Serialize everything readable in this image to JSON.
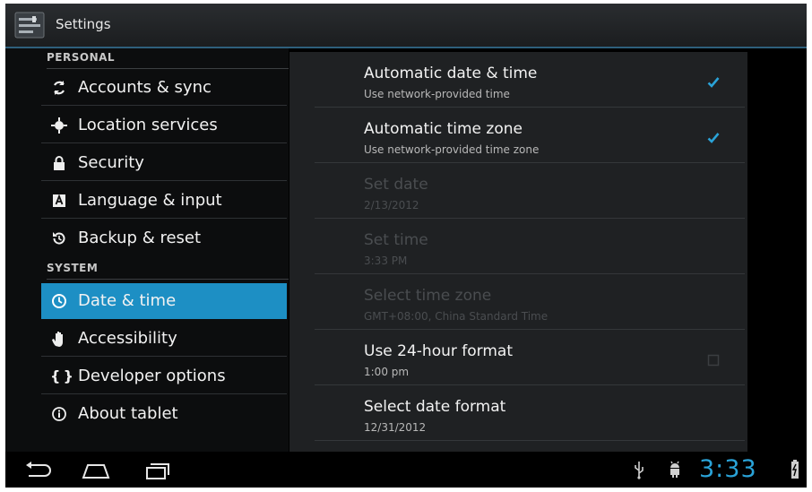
{
  "actionbar": {
    "title": "Settings",
    "icon": "settings-app-icon"
  },
  "sidebar": {
    "personal_header": "PERSONAL",
    "system_header": "SYSTEM",
    "personal_items": [
      {
        "label": "Accounts & sync",
        "icon": "sync-icon"
      },
      {
        "label": "Location services",
        "icon": "location-icon"
      },
      {
        "label": "Security",
        "icon": "lock-icon"
      },
      {
        "label": "Language & input",
        "icon": "keyboard-icon"
      },
      {
        "label": "Backup & reset",
        "icon": "backup-icon"
      }
    ],
    "system_items": [
      {
        "label": "Date & time",
        "icon": "clock-icon",
        "selected": true
      },
      {
        "label": "Accessibility",
        "icon": "hand-icon"
      },
      {
        "label": "Developer options",
        "icon": "braces-icon"
      },
      {
        "label": "About tablet",
        "icon": "info-icon"
      }
    ]
  },
  "detail": {
    "prefs": [
      {
        "title": "Automatic date & time",
        "summary": "Use network-provided time",
        "checked": true,
        "enabled": true
      },
      {
        "title": "Automatic time zone",
        "summary": "Use network-provided time zone",
        "checked": true,
        "enabled": true
      },
      {
        "title": "Set date",
        "summary": "2/13/2012",
        "enabled": false
      },
      {
        "title": "Set time",
        "summary": "3:33 PM",
        "enabled": false
      },
      {
        "title": "Select time zone",
        "summary": "GMT+08:00, China Standard Time",
        "enabled": false
      },
      {
        "title": "Use 24-hour format",
        "summary": "1:00 pm",
        "checked": false,
        "enabled": true
      },
      {
        "title": "Select date format",
        "summary": "12/31/2012",
        "enabled": true
      }
    ]
  },
  "systembar": {
    "clock": "3:33"
  },
  "colors": {
    "accent": "#1d8fc4",
    "clock": "#2aa3d8"
  }
}
